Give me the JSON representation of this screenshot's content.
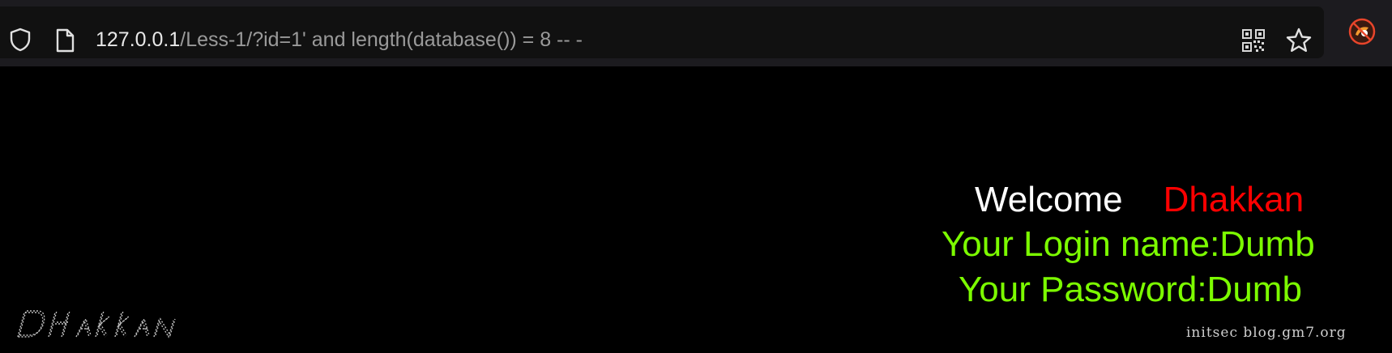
{
  "browser": {
    "url_host": "127.0.0.1",
    "url_path": "/Less-1/?id=1' and length(database()) = 8 -- -",
    "icons": {
      "tracking_protection": "shield-icon",
      "page_info": "page-icon",
      "qr_code": "qr-code-icon",
      "bookmark": "star-icon",
      "extension": "extension-icon"
    }
  },
  "content": {
    "welcome_word": "Welcome",
    "welcome_name": "Dhakkan",
    "login_line": "Your Login name:Dumb",
    "password_line": "Your Password:Dumb",
    "credit": "initsec blog.gm7.org",
    "logo_text": "Dhakkan"
  },
  "colors": {
    "background": "#000000",
    "toolbar": "#1c1b1f",
    "welcome": "#ffffff",
    "name": "#ff0000",
    "credentials": "#7cfc00"
  }
}
